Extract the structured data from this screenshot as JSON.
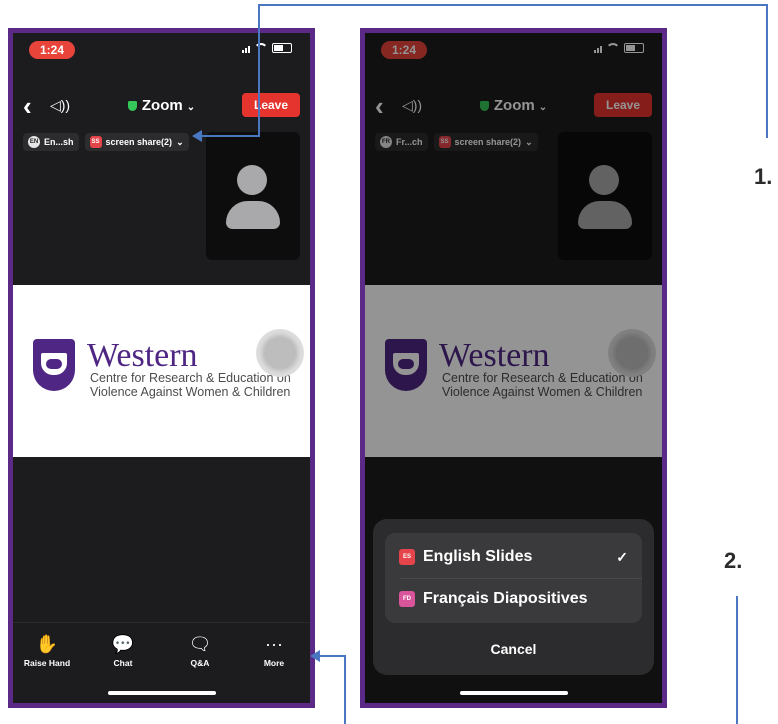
{
  "status": {
    "time": "1:24"
  },
  "nav": {
    "back": "‹",
    "speaker": "◁))",
    "title": "Zoom",
    "title_chevron": "⌄",
    "leave": "Leave"
  },
  "left_chips": {
    "lang_badge": "EN",
    "lang_label": "En...sh",
    "share_badge": "SS",
    "share_label": "screen share(2)",
    "chevron": "⌄"
  },
  "right_chips": {
    "lang_badge": "FR",
    "lang_label": "Fr...ch",
    "share_badge": "SS",
    "share_label": "screen share(2)",
    "chevron": "⌄"
  },
  "slide": {
    "brand": "Western",
    "line1": "Centre for Research & Education on",
    "line2": "Violence Against Women & Children"
  },
  "toolbar": {
    "raise_hand": "Raise Hand",
    "chat": "Chat",
    "qa": "Q&A",
    "more": "More",
    "more_icon": "···"
  },
  "sheet": {
    "options": [
      {
        "badge": "ES",
        "label": "English Slides",
        "selected": true
      },
      {
        "badge": "FD",
        "label": "Français Diapositives",
        "selected": false
      }
    ],
    "check": "✓",
    "cancel": "Cancel"
  },
  "annotations": {
    "step1": "1.",
    "step2": "2."
  },
  "colors": {
    "frame": "#5b2a86",
    "leave": "#e5342d",
    "accent_line": "#4a77c2",
    "brand": "#4f2683"
  }
}
